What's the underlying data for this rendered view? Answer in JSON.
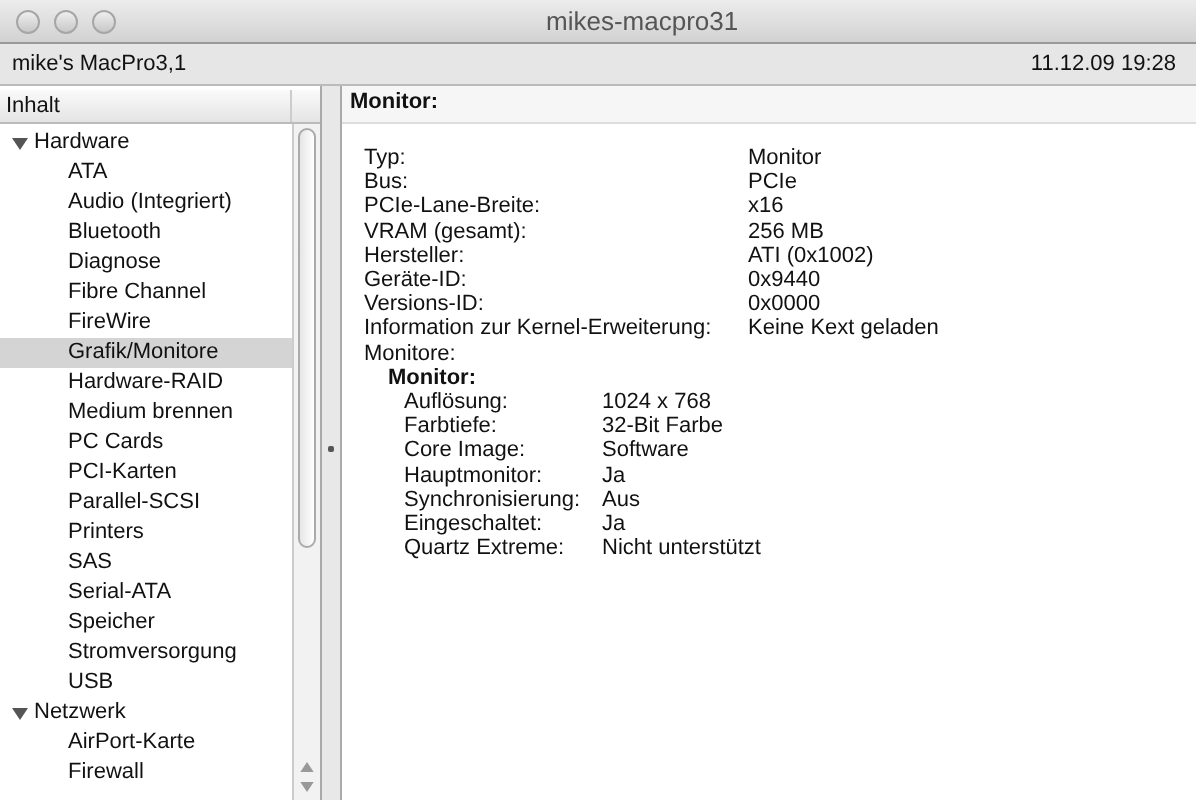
{
  "window": {
    "title": "mikes-macpro31"
  },
  "info_bar": {
    "computer": "mike's MacPro3,1",
    "datetime": "11.12.09 19:28"
  },
  "sidebar": {
    "header": "Inhalt",
    "items": [
      {
        "label": "Hardware",
        "expanded": true,
        "selected": false,
        "children": [
          {
            "label": "ATA",
            "selected": false
          },
          {
            "label": "Audio (Integriert)",
            "selected": false
          },
          {
            "label": "Bluetooth",
            "selected": false
          },
          {
            "label": "Diagnose",
            "selected": false
          },
          {
            "label": "Fibre Channel",
            "selected": false
          },
          {
            "label": "FireWire",
            "selected": false
          },
          {
            "label": "Grafik/Monitore",
            "selected": true
          },
          {
            "label": "Hardware-RAID",
            "selected": false
          },
          {
            "label": "Medium brennen",
            "selected": false
          },
          {
            "label": "PC Cards",
            "selected": false
          },
          {
            "label": "PCI-Karten",
            "selected": false
          },
          {
            "label": "Parallel-SCSI",
            "selected": false
          },
          {
            "label": "Printers",
            "selected": false
          },
          {
            "label": "SAS",
            "selected": false
          },
          {
            "label": "Serial-ATA",
            "selected": false
          },
          {
            "label": "Speicher",
            "selected": false
          },
          {
            "label": "Stromversorgung",
            "selected": false
          },
          {
            "label": "USB",
            "selected": false
          }
        ]
      },
      {
        "label": "Netzwerk",
        "expanded": true,
        "selected": false,
        "children": [
          {
            "label": "AirPort-Karte",
            "selected": false
          },
          {
            "label": "Firewall",
            "selected": false
          }
        ]
      }
    ]
  },
  "detail": {
    "heading": "Monitor:",
    "properties": [
      {
        "key": "Typ:",
        "value": "Monitor"
      },
      {
        "key": "Bus:",
        "value": "PCIe"
      },
      {
        "key": "PCIe-Lane-Breite:",
        "value": "x16"
      },
      {
        "key": "VRAM (gesamt):",
        "value": "256 MB"
      },
      {
        "key": "Hersteller:",
        "value": "ATI (0x1002)"
      },
      {
        "key": "Geräte-ID:",
        "value": "0x9440"
      },
      {
        "key": "Versions-ID:",
        "value": "0x0000"
      },
      {
        "key": "Information zur Kernel-Erweiterung:",
        "value": "Keine Kext geladen"
      }
    ],
    "group": {
      "label": "Monitore:",
      "subheading": "Monitor:",
      "properties": [
        {
          "key": "Auflösung:",
          "value": "1024 x 768"
        },
        {
          "key": "Farbtiefe:",
          "value": "32-Bit Farbe"
        },
        {
          "key": "Core Image:",
          "value": "Software"
        },
        {
          "key": "Hauptmonitor:",
          "value": "Ja"
        },
        {
          "key": "Synchronisierung:",
          "value": "Aus"
        },
        {
          "key": "Eingeschaltet:",
          "value": "Ja"
        },
        {
          "key": "Quartz Extreme:",
          "value": "Nicht unterstützt"
        }
      ]
    }
  }
}
